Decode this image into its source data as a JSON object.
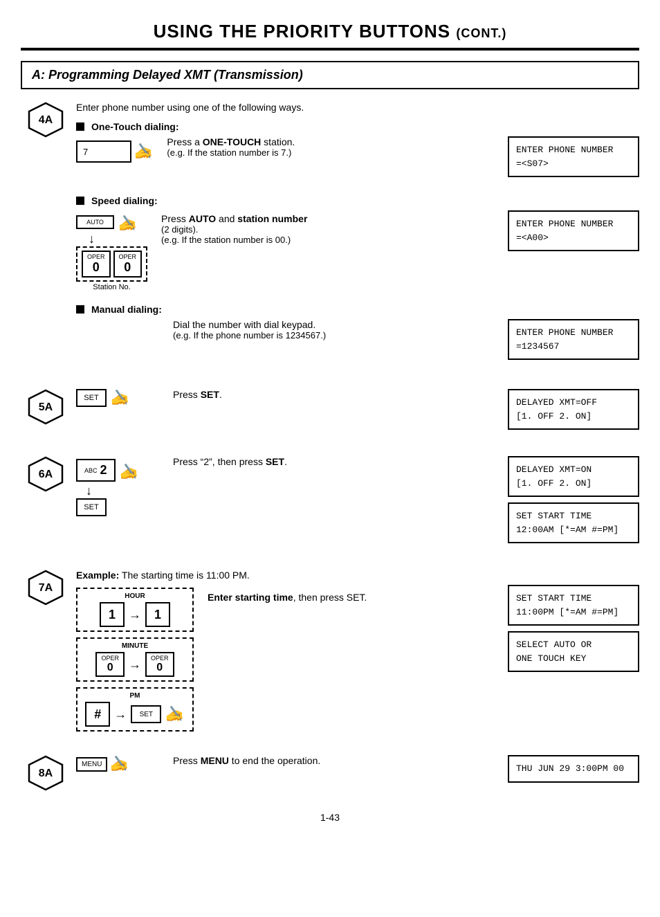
{
  "page": {
    "title_main": "USING THE PRIORITY BUTTONS",
    "title_cont": "(CONT.)",
    "section_title": "A:  Programming Delayed XMT (Transmission)",
    "footer_page": "1-43",
    "steps": {
      "step4A": {
        "badge": "4A",
        "intro": "Enter phone number using one of the following ways.",
        "onetouch_label": "One-Touch dialing:",
        "onetouch_instruction": "Press a ONE-TOUCH station.",
        "onetouch_example": "(e.g. If the station number is 7.)",
        "onetouch_key_value": "7",
        "onetouch_display": "ENTER PHONE NUMBER\n=<S07>",
        "speed_label": "Speed dialing:",
        "speed_instruction_bold": "Press AUTO and station number",
        "speed_instruction_rest": "\n(2 digits).\n(e.g. If the station number is 00.)",
        "speed_display": "ENTER PHONE NUMBER\n=<A00>",
        "auto_key_label": "AUTO",
        "station_key1_label": "OPER",
        "station_key1_val": "0",
        "station_key2_label": "OPER",
        "station_key2_val": "0",
        "station_no_text": "Station No.",
        "manual_label": "Manual dialing:",
        "manual_instruction": "Dial the number with dial keypad.",
        "manual_example": "(e.g. If the phone number is 1234567.)",
        "manual_display": "ENTER PHONE NUMBER\n=1234567"
      },
      "step5A": {
        "badge": "5A",
        "set_key_label": "SET",
        "instruction": "Press SET.",
        "display": "DELAYED XMT=OFF\n[1. OFF 2. ON]"
      },
      "step6A": {
        "badge": "6A",
        "abc_label": "ABC",
        "key_val": "2",
        "set_key_label": "SET",
        "instruction_pre": "Press “2”, then press ",
        "instruction_bold": "SET",
        "instruction_post": ".",
        "display1": "DELAYED XMT=ON\n[1. OFF 2. ON]",
        "display2": "SET START TIME\n12:00AM [*=AM #=PM]"
      },
      "step7A": {
        "badge": "7A",
        "example_text": "Example:",
        "example_detail": " The starting time is 11:00 PM.",
        "hour_label": "HOUR",
        "minute_label": "MINUTE",
        "pm_label": "PM",
        "hour_key1": "1",
        "hour_key2": "1",
        "min_key1_label": "OPER",
        "min_key1_val": "0",
        "min_key2_label": "OPER",
        "min_key2_val": "0",
        "pm_key": "#",
        "set_key_label": "SET",
        "instruction_bold": "Enter starting time",
        "instruction_rest": ", then press SET.",
        "display1": "SET START TIME\n11:00PM [*=AM #=PM]",
        "display2": "SELECT AUTO OR\nONE TOUCH KEY"
      },
      "step8A": {
        "badge": "8A",
        "menu_key_label": "MENU",
        "instruction_pre": "Press ",
        "instruction_bold": "MENU",
        "instruction_rest": " to end the operation.",
        "display": "THU JUN 29 3:00PM 00"
      }
    }
  }
}
